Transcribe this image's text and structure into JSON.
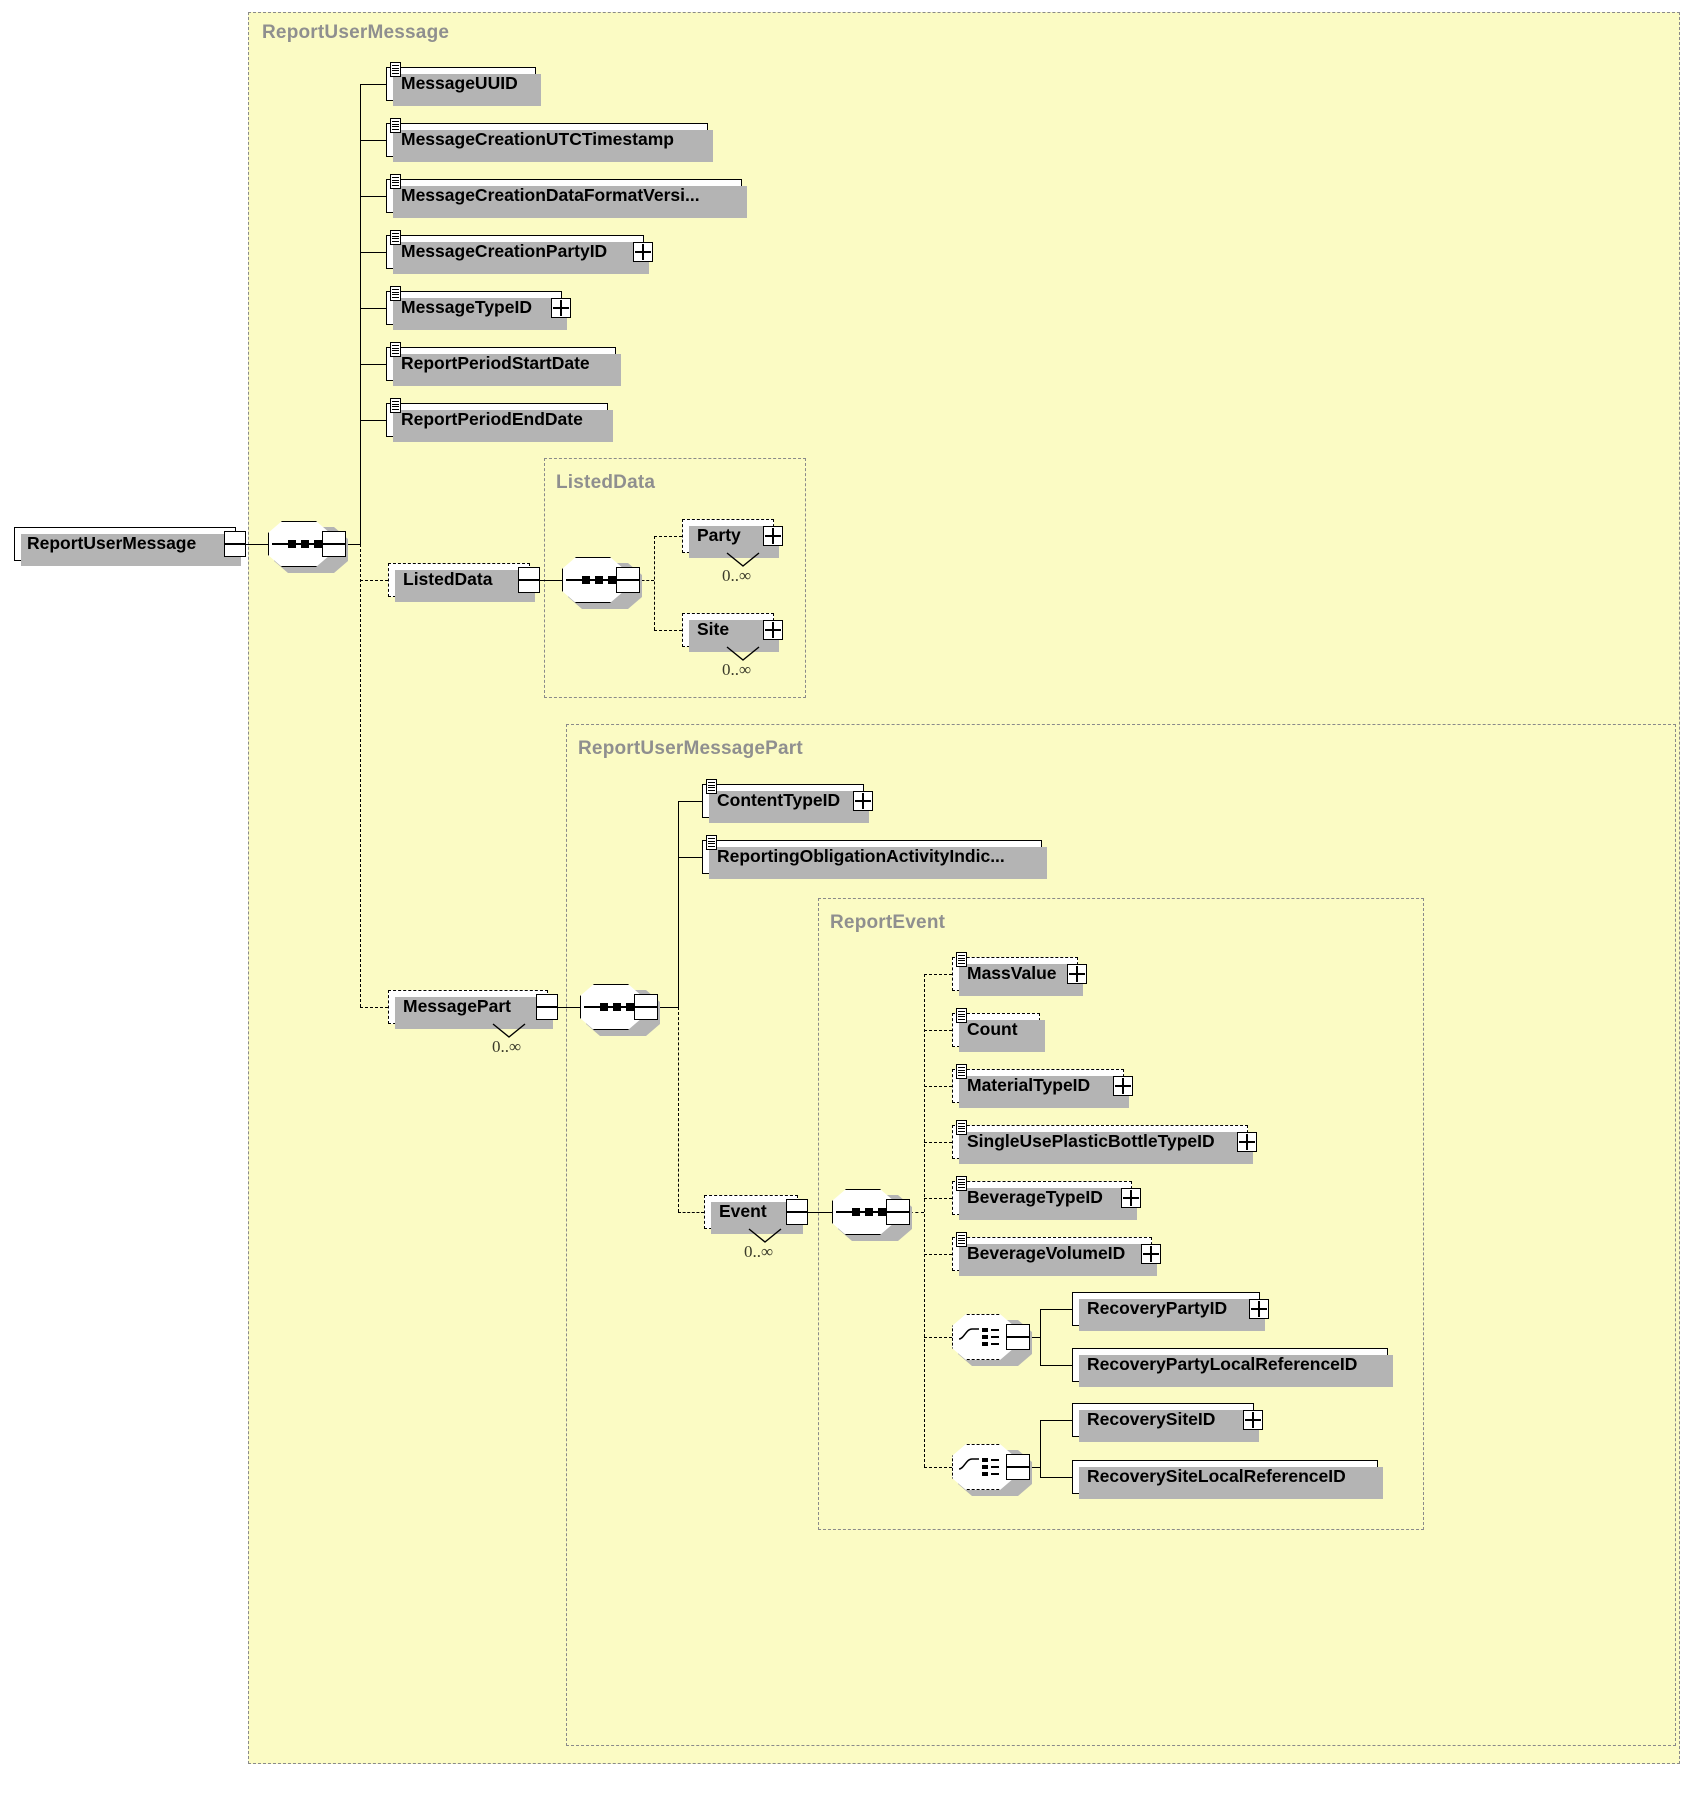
{
  "diagram": {
    "title": "ReportUserMessage XSD structure",
    "root_element": "ReportUserMessage",
    "colors": {
      "group_fill": "#fbfbc4",
      "group_border": "#8a8a8a",
      "group_title": "#8f8f8f",
      "node_fill": "#ffffff",
      "node_border": "#000000",
      "shadow": "#b4b4b4"
    },
    "cardinality_unbounded": "0..∞"
  },
  "groups": {
    "report_user_message": {
      "title": "ReportUserMessage"
    },
    "listed_data": {
      "title": "ListedData"
    },
    "report_user_message_part": {
      "title": "ReportUserMessagePart"
    },
    "report_event": {
      "title": "ReportEvent"
    }
  },
  "nodes": {
    "root": {
      "label": "ReportUserMessage"
    },
    "message_uuid": {
      "label": "MessageUUID"
    },
    "message_creation_utc_timestamp": {
      "label": "MessageCreationUTCTimestamp"
    },
    "message_creation_data_format_version": {
      "label": "MessageCreationDataFormatVersi..."
    },
    "message_creation_party_id": {
      "label": "MessageCreationPartyID"
    },
    "message_type_id": {
      "label": "MessageTypeID"
    },
    "report_period_start_date": {
      "label": "ReportPeriodStartDate"
    },
    "report_period_end_date": {
      "label": "ReportPeriodEndDate"
    },
    "listed_data": {
      "label": "ListedData"
    },
    "party": {
      "label": "Party",
      "cardinality": "0..∞"
    },
    "site": {
      "label": "Site",
      "cardinality": "0..∞"
    },
    "message_part": {
      "label": "MessagePart",
      "cardinality": "0..∞"
    },
    "content_type_id": {
      "label": "ContentTypeID"
    },
    "reporting_obligation_activity_indicator": {
      "label": "ReportingObligationActivityIndic..."
    },
    "event": {
      "label": "Event",
      "cardinality": "0..∞"
    },
    "mass_value": {
      "label": "MassValue"
    },
    "count": {
      "label": "Count"
    },
    "material_type_id": {
      "label": "MaterialTypeID"
    },
    "single_use_plastic_bottle_type_id": {
      "label": "SingleUsePlasticBottleTypeID"
    },
    "beverage_type_id": {
      "label": "BeverageTypeID"
    },
    "beverage_volume_id": {
      "label": "BeverageVolumeID"
    },
    "recovery_party_id": {
      "label": "RecoveryPartyID"
    },
    "recovery_party_local_reference_id": {
      "label": "RecoveryPartyLocalReferenceID"
    },
    "recovery_site_id": {
      "label": "RecoverySiteID"
    },
    "recovery_site_local_reference_id": {
      "label": "RecoverySiteLocalReferenceID"
    }
  },
  "icons": {
    "sequence": "sequence-compositor-icon",
    "choice": "choice-compositor-icon",
    "expand": "plus-expand-icon",
    "element_lines": "element-type-lines-icon"
  }
}
